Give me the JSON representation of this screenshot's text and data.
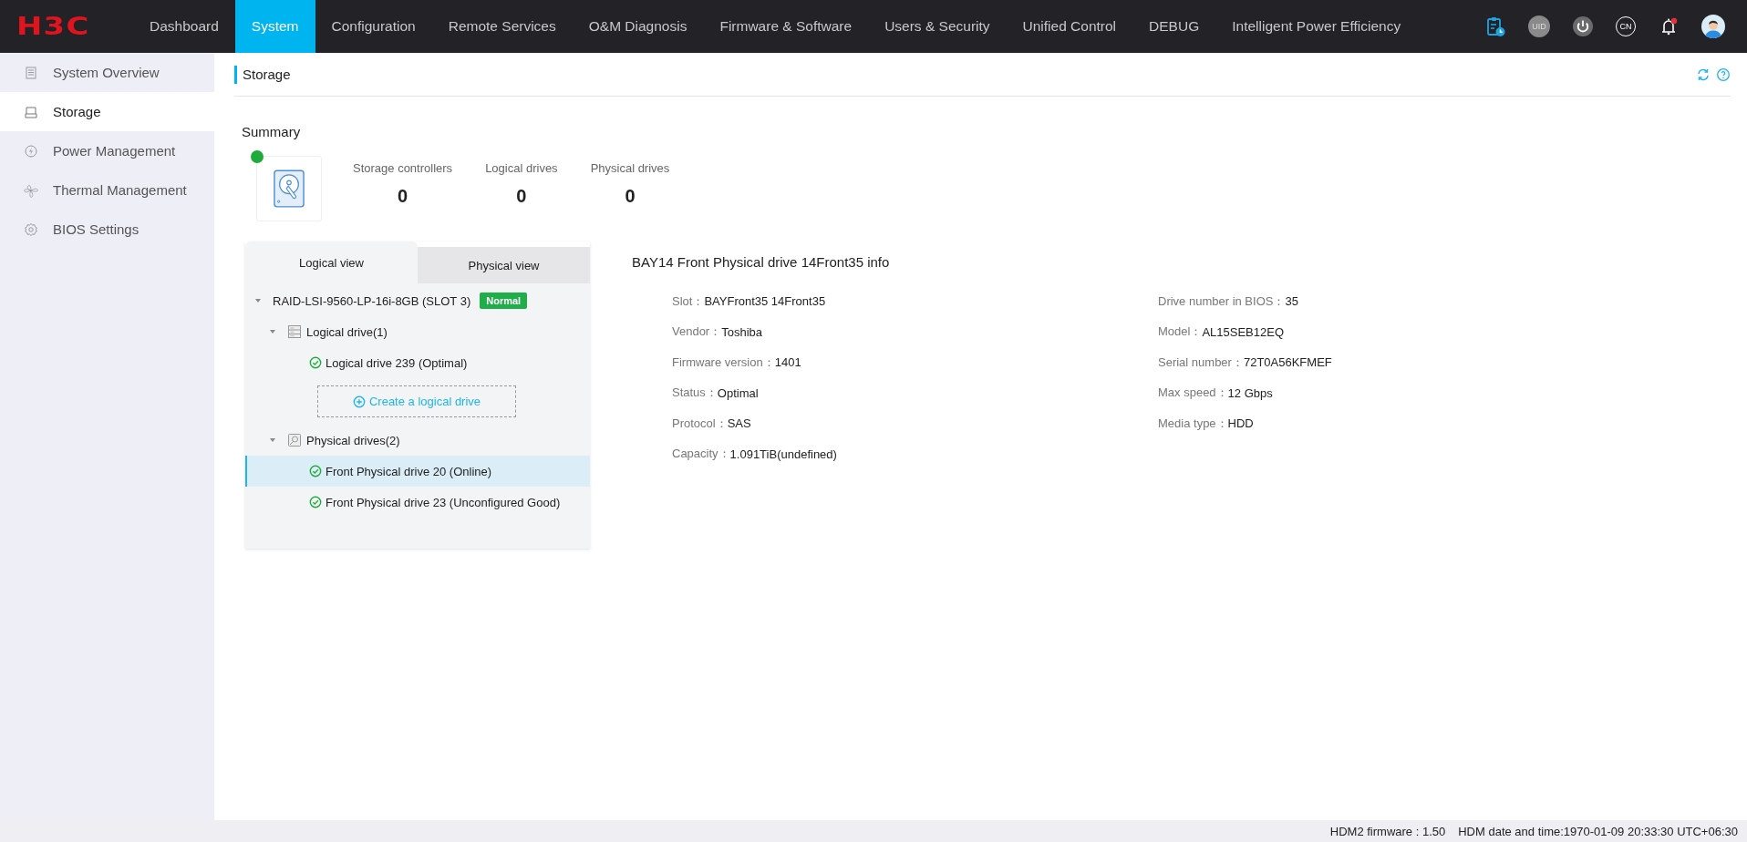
{
  "logo": "H3C",
  "nav": [
    {
      "label": "Dashboard",
      "selected": false
    },
    {
      "label": "System",
      "selected": true
    },
    {
      "label": "Configuration",
      "selected": false
    },
    {
      "label": "Remote Services",
      "selected": false
    },
    {
      "label": "O&M Diagnosis",
      "selected": false
    },
    {
      "label": "Firmware & Software",
      "selected": false
    },
    {
      "label": "Users & Security",
      "selected": false
    },
    {
      "label": "Unified Control",
      "selected": false
    },
    {
      "label": "DEBUG",
      "selected": false
    },
    {
      "label": "Intelligent Power Efficiency",
      "selected": false
    }
  ],
  "toolbar": [
    {
      "kind": "task"
    },
    {
      "kind": "uid",
      "label": "UID"
    },
    {
      "kind": "power"
    },
    {
      "kind": "lang",
      "label": "CN"
    },
    {
      "kind": "bell",
      "alert": true
    },
    {
      "kind": "user"
    }
  ],
  "sidebar": {
    "items": [
      {
        "kind": "list",
        "label": "System Overview",
        "selected": false
      },
      {
        "kind": "disk",
        "label": "Storage",
        "selected": true
      },
      {
        "kind": "power",
        "label": "Power Management",
        "selected": false
      },
      {
        "kind": "fan",
        "label": "Thermal Management",
        "selected": false
      },
      {
        "kind": "gear",
        "label": "BIOS Settings",
        "selected": false
      }
    ]
  },
  "page": {
    "title": "Storage"
  },
  "summary": {
    "title": "Summary",
    "healthy": true,
    "stats": [
      {
        "label": "Storage controllers",
        "value": "0"
      },
      {
        "label": "Logical drives",
        "value": "0"
      },
      {
        "label": "Physical drives",
        "value": "0"
      }
    ]
  },
  "tree_tabs": [
    {
      "label": "Logical view",
      "selected": true
    },
    {
      "label": "Physical view",
      "selected": false
    }
  ],
  "tree": [
    {
      "label": "RAID-LSI-9560-LP-16i-8GB (SLOT 3)",
      "badge": "Normal",
      "expanded": true,
      "children": [
        {
          "kind": "logical",
          "label": "Logical drive(1)",
          "expanded": true,
          "children": [
            {
              "kind": "drive",
              "label": "Logical drive 239 (Optimal)",
              "selected": false
            },
            {
              "kind": "create",
              "label": "Create a logical drive"
            }
          ]
        },
        {
          "kind": "physical",
          "label": "Physical drives(2)",
          "expanded": true,
          "children": [
            {
              "kind": "drive",
              "label": "Front Physical drive 20 (Online)",
              "selected": true
            },
            {
              "kind": "drive",
              "label": "Front Physical drive 23 (Unconfigured Good)",
              "selected": false
            }
          ]
        }
      ]
    }
  ],
  "details": {
    "title": "BAY14 Front Physical drive 14Front35 info",
    "left": [
      {
        "label": "Slot：",
        "value": "BAYFront35 14Front35"
      },
      {
        "label": "Vendor：",
        "value": "Toshiba"
      },
      {
        "label": "Firmware version：",
        "value": "1401"
      },
      {
        "label": "Status：",
        "value": "Optimal"
      },
      {
        "label": "Protocol：",
        "value": "SAS"
      },
      {
        "label": "Capacity：",
        "value": "1.091TiB(undefined)"
      }
    ],
    "right": [
      {
        "label": "Drive number in BIOS：",
        "value": "35"
      },
      {
        "label": "Model：",
        "value": "AL15SEB12EQ"
      },
      {
        "label": "Serial number：",
        "value": "72T0A56KFMEF"
      },
      {
        "label": "Max speed：",
        "value": "12 Gbps"
      },
      {
        "label": "Media type：",
        "value": "HDD"
      }
    ]
  },
  "footer": [
    "HDM2 firmware : 1.50",
    "HDM date and time:1970-01-09 20:33:30 UTC+06:30"
  ]
}
